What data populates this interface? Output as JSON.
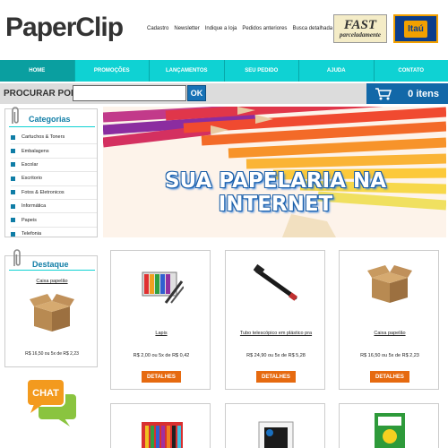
{
  "header": {
    "logo_text": "PaperClip",
    "top_links": [
      "Cadastro",
      "Newsletter",
      "Indique a loja",
      "Pedidos anteriores",
      "Busca detalhada"
    ],
    "partner_badges": [
      {
        "line1": "FAST",
        "line2": "parceladamente"
      },
      {
        "label": "Itaú"
      }
    ]
  },
  "nav": {
    "items": [
      "HOME",
      "PROMOÇÕES",
      "LANÇAMENTOS",
      "SEU PEDIDO",
      "AJUDA",
      "CONTATO"
    ],
    "active": "HOME"
  },
  "search": {
    "label": "PROCURAR POR:",
    "value": "",
    "placeholder": "",
    "button": "OK"
  },
  "cart": {
    "icon": "cart-icon",
    "count_text": "0 itens"
  },
  "categories": {
    "title": "Categorias",
    "items": [
      "Cartuchos & Toners",
      "Embalagens",
      "Escolar",
      "Escritorio",
      "Fotos & Eletronicos",
      "Informática",
      "Papeis",
      "Telefonia"
    ]
  },
  "banner": {
    "title": "SUA PAPELARIA NA INTERNET"
  },
  "destaque": {
    "title": "Destaque",
    "product_name": "Caixa papelão",
    "price": "R$ 16,50 ou 5x de R$ 2,23"
  },
  "chat": {
    "label": "CHAT"
  },
  "products": [
    {
      "name": "Lapis",
      "price": "R$ 2,00 ou 5x de R$ 0,42",
      "button": "DETALHES",
      "icon": "pencils-icon"
    },
    {
      "name": "Tubo telescópico em plástico pra",
      "price": "R$ 24,90 ou 5x de R$ 5,28",
      "button": "DETALHES",
      "icon": "tube-icon"
    },
    {
      "name": "Caixa papelão",
      "price": "R$ 16,50 ou 5x de R$ 2,23",
      "button": "DETALHES",
      "icon": "box-icon"
    }
  ],
  "colors": {
    "nav": "#0fd2d3",
    "accent_blue": "#0f7da6",
    "button_orange": "#e66a10",
    "cart_blue": "#1268a8"
  }
}
